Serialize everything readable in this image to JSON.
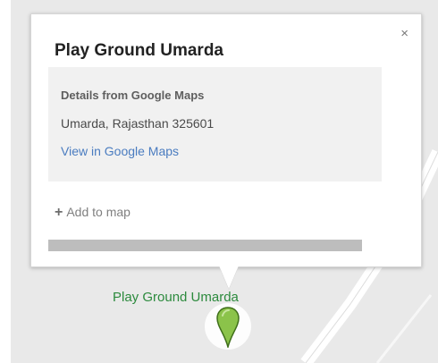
{
  "popup": {
    "title": "Play Ground Umarda",
    "close_label": "×",
    "details_heading": "Details from Google Maps",
    "address": "Umarda, Rajasthan 325601",
    "view_link": "View in Google Maps",
    "add_to_map": "Add to map"
  },
  "map": {
    "place_label": "Play Ground Umarda",
    "pin_color": "#8bc34a"
  },
  "colors": {
    "link": "#4a7cc0",
    "place_label": "#2c8a3d"
  }
}
